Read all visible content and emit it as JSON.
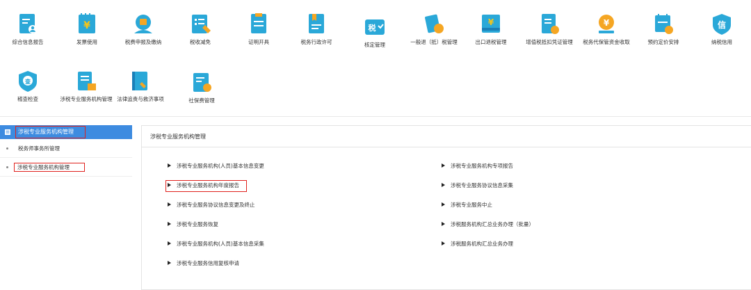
{
  "top_icons": [
    {
      "label": "综合信息报告",
      "icon": "report-person-icon"
    },
    {
      "label": "发票使用",
      "icon": "invoice-yuan-icon"
    },
    {
      "label": "税费申报及缴纳",
      "icon": "tax-declare-icon"
    },
    {
      "label": "税收减免",
      "icon": "tax-relief-icon"
    },
    {
      "label": "证明开具",
      "icon": "certificate-icon"
    },
    {
      "label": "税务行政许可",
      "icon": "admin-license-icon"
    },
    {
      "label": "核定管理",
      "icon": "verify-tax-icon"
    },
    {
      "label": "一般退（抵）税管理",
      "icon": "refund-icon"
    },
    {
      "label": "出口退税管理",
      "icon": "export-refund-icon"
    },
    {
      "label": "增值税抵扣凭证管理",
      "icon": "vat-voucher-icon"
    },
    {
      "label": "税务代保管资金收取",
      "icon": "custody-fund-icon"
    },
    {
      "label": "预约定价安排",
      "icon": "pricing-calendar-icon"
    },
    {
      "label": "纳税信用",
      "icon": "credit-badge-icon"
    },
    {
      "label": "稽查检查",
      "icon": "inspection-shield-icon"
    },
    {
      "label": "涉税专业服务机构管理",
      "icon": "agency-building-icon"
    },
    {
      "label": "法律追责与救济事项",
      "icon": "legal-book-icon"
    },
    {
      "label": "社保费管理",
      "icon": "social-security-icon"
    }
  ],
  "sidebar": {
    "header": "涉税专业服务机构管理",
    "items": [
      {
        "label": "税务师事务所管理"
      },
      {
        "label": "涉税专业服务机构管理"
      }
    ]
  },
  "main": {
    "title": "涉税专业服务机构管理",
    "left_links": [
      "涉税专业服务机构(人员)基本信息变更",
      "涉税专业服务机构年度报告",
      "涉税专业服务协议信息变更及终止",
      "涉税专业服务恢复",
      "涉税专业服务机构(人员)基本信息采集",
      "涉税专业服务信用复核申请"
    ],
    "right_links": [
      "涉税专业服务机构专项报告",
      "涉税专业服务协议信息采集",
      "涉税专业服务中止",
      "涉税服务机构汇总业务办理（批量）",
      "涉税服务机构汇总业务办理"
    ]
  },
  "colors": {
    "accent_blue": "#3d8be0",
    "highlight_red": "#e0201c",
    "icon_teal": "#2aa8d8"
  }
}
